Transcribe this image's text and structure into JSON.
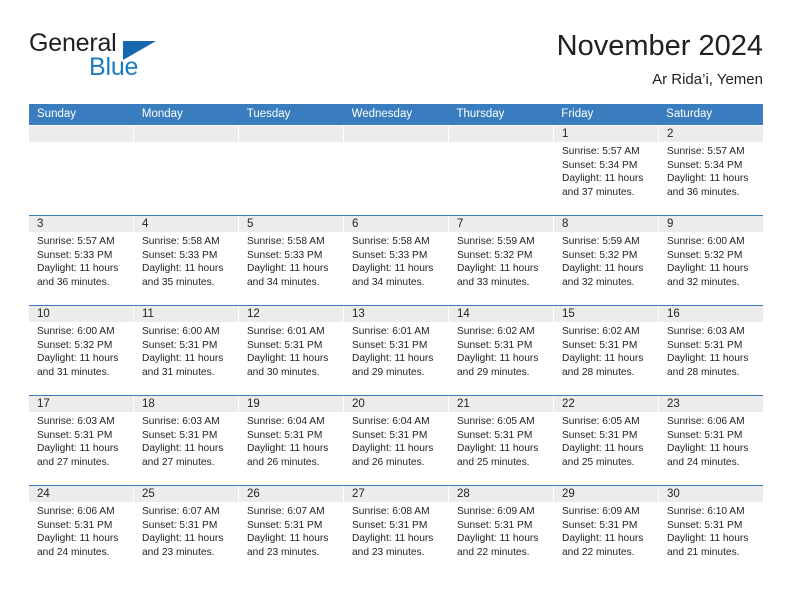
{
  "brand": {
    "name_part1": "General",
    "name_part2": "Blue",
    "accent_color": "#1a7cc2",
    "triangle_color": "#1567b0"
  },
  "header": {
    "title": "November 2024",
    "subtitle": "Ar Rida’i, Yemen"
  },
  "theme": {
    "header_blue": "#3a7dbf",
    "day_number_bg": "#ececec",
    "text": "#231f20"
  },
  "weekdays": [
    "Sunday",
    "Monday",
    "Tuesday",
    "Wednesday",
    "Thursday",
    "Friday",
    "Saturday"
  ],
  "weeks": [
    [
      {
        "day": "",
        "sunrise": "",
        "sunset": "",
        "daylight1": "",
        "daylight2": ""
      },
      {
        "day": "",
        "sunrise": "",
        "sunset": "",
        "daylight1": "",
        "daylight2": ""
      },
      {
        "day": "",
        "sunrise": "",
        "sunset": "",
        "daylight1": "",
        "daylight2": ""
      },
      {
        "day": "",
        "sunrise": "",
        "sunset": "",
        "daylight1": "",
        "daylight2": ""
      },
      {
        "day": "",
        "sunrise": "",
        "sunset": "",
        "daylight1": "",
        "daylight2": ""
      },
      {
        "day": "1",
        "sunrise": "Sunrise: 5:57 AM",
        "sunset": "Sunset: 5:34 PM",
        "daylight1": "Daylight: 11 hours",
        "daylight2": "and 37 minutes."
      },
      {
        "day": "2",
        "sunrise": "Sunrise: 5:57 AM",
        "sunset": "Sunset: 5:34 PM",
        "daylight1": "Daylight: 11 hours",
        "daylight2": "and 36 minutes."
      }
    ],
    [
      {
        "day": "3",
        "sunrise": "Sunrise: 5:57 AM",
        "sunset": "Sunset: 5:33 PM",
        "daylight1": "Daylight: 11 hours",
        "daylight2": "and 36 minutes."
      },
      {
        "day": "4",
        "sunrise": "Sunrise: 5:58 AM",
        "sunset": "Sunset: 5:33 PM",
        "daylight1": "Daylight: 11 hours",
        "daylight2": "and 35 minutes."
      },
      {
        "day": "5",
        "sunrise": "Sunrise: 5:58 AM",
        "sunset": "Sunset: 5:33 PM",
        "daylight1": "Daylight: 11 hours",
        "daylight2": "and 34 minutes."
      },
      {
        "day": "6",
        "sunrise": "Sunrise: 5:58 AM",
        "sunset": "Sunset: 5:33 PM",
        "daylight1": "Daylight: 11 hours",
        "daylight2": "and 34 minutes."
      },
      {
        "day": "7",
        "sunrise": "Sunrise: 5:59 AM",
        "sunset": "Sunset: 5:32 PM",
        "daylight1": "Daylight: 11 hours",
        "daylight2": "and 33 minutes."
      },
      {
        "day": "8",
        "sunrise": "Sunrise: 5:59 AM",
        "sunset": "Sunset: 5:32 PM",
        "daylight1": "Daylight: 11 hours",
        "daylight2": "and 32 minutes."
      },
      {
        "day": "9",
        "sunrise": "Sunrise: 6:00 AM",
        "sunset": "Sunset: 5:32 PM",
        "daylight1": "Daylight: 11 hours",
        "daylight2": "and 32 minutes."
      }
    ],
    [
      {
        "day": "10",
        "sunrise": "Sunrise: 6:00 AM",
        "sunset": "Sunset: 5:32 PM",
        "daylight1": "Daylight: 11 hours",
        "daylight2": "and 31 minutes."
      },
      {
        "day": "11",
        "sunrise": "Sunrise: 6:00 AM",
        "sunset": "Sunset: 5:31 PM",
        "daylight1": "Daylight: 11 hours",
        "daylight2": "and 31 minutes."
      },
      {
        "day": "12",
        "sunrise": "Sunrise: 6:01 AM",
        "sunset": "Sunset: 5:31 PM",
        "daylight1": "Daylight: 11 hours",
        "daylight2": "and 30 minutes."
      },
      {
        "day": "13",
        "sunrise": "Sunrise: 6:01 AM",
        "sunset": "Sunset: 5:31 PM",
        "daylight1": "Daylight: 11 hours",
        "daylight2": "and 29 minutes."
      },
      {
        "day": "14",
        "sunrise": "Sunrise: 6:02 AM",
        "sunset": "Sunset: 5:31 PM",
        "daylight1": "Daylight: 11 hours",
        "daylight2": "and 29 minutes."
      },
      {
        "day": "15",
        "sunrise": "Sunrise: 6:02 AM",
        "sunset": "Sunset: 5:31 PM",
        "daylight1": "Daylight: 11 hours",
        "daylight2": "and 28 minutes."
      },
      {
        "day": "16",
        "sunrise": "Sunrise: 6:03 AM",
        "sunset": "Sunset: 5:31 PM",
        "daylight1": "Daylight: 11 hours",
        "daylight2": "and 28 minutes."
      }
    ],
    [
      {
        "day": "17",
        "sunrise": "Sunrise: 6:03 AM",
        "sunset": "Sunset: 5:31 PM",
        "daylight1": "Daylight: 11 hours",
        "daylight2": "and 27 minutes."
      },
      {
        "day": "18",
        "sunrise": "Sunrise: 6:03 AM",
        "sunset": "Sunset: 5:31 PM",
        "daylight1": "Daylight: 11 hours",
        "daylight2": "and 27 minutes."
      },
      {
        "day": "19",
        "sunrise": "Sunrise: 6:04 AM",
        "sunset": "Sunset: 5:31 PM",
        "daylight1": "Daylight: 11 hours",
        "daylight2": "and 26 minutes."
      },
      {
        "day": "20",
        "sunrise": "Sunrise: 6:04 AM",
        "sunset": "Sunset: 5:31 PM",
        "daylight1": "Daylight: 11 hours",
        "daylight2": "and 26 minutes."
      },
      {
        "day": "21",
        "sunrise": "Sunrise: 6:05 AM",
        "sunset": "Sunset: 5:31 PM",
        "daylight1": "Daylight: 11 hours",
        "daylight2": "and 25 minutes."
      },
      {
        "day": "22",
        "sunrise": "Sunrise: 6:05 AM",
        "sunset": "Sunset: 5:31 PM",
        "daylight1": "Daylight: 11 hours",
        "daylight2": "and 25 minutes."
      },
      {
        "day": "23",
        "sunrise": "Sunrise: 6:06 AM",
        "sunset": "Sunset: 5:31 PM",
        "daylight1": "Daylight: 11 hours",
        "daylight2": "and 24 minutes."
      }
    ],
    [
      {
        "day": "24",
        "sunrise": "Sunrise: 6:06 AM",
        "sunset": "Sunset: 5:31 PM",
        "daylight1": "Daylight: 11 hours",
        "daylight2": "and 24 minutes."
      },
      {
        "day": "25",
        "sunrise": "Sunrise: 6:07 AM",
        "sunset": "Sunset: 5:31 PM",
        "daylight1": "Daylight: 11 hours",
        "daylight2": "and 23 minutes."
      },
      {
        "day": "26",
        "sunrise": "Sunrise: 6:07 AM",
        "sunset": "Sunset: 5:31 PM",
        "daylight1": "Daylight: 11 hours",
        "daylight2": "and 23 minutes."
      },
      {
        "day": "27",
        "sunrise": "Sunrise: 6:08 AM",
        "sunset": "Sunset: 5:31 PM",
        "daylight1": "Daylight: 11 hours",
        "daylight2": "and 23 minutes."
      },
      {
        "day": "28",
        "sunrise": "Sunrise: 6:09 AM",
        "sunset": "Sunset: 5:31 PM",
        "daylight1": "Daylight: 11 hours",
        "daylight2": "and 22 minutes."
      },
      {
        "day": "29",
        "sunrise": "Sunrise: 6:09 AM",
        "sunset": "Sunset: 5:31 PM",
        "daylight1": "Daylight: 11 hours",
        "daylight2": "and 22 minutes."
      },
      {
        "day": "30",
        "sunrise": "Sunrise: 6:10 AM",
        "sunset": "Sunset: 5:31 PM",
        "daylight1": "Daylight: 11 hours",
        "daylight2": "and 21 minutes."
      }
    ]
  ]
}
